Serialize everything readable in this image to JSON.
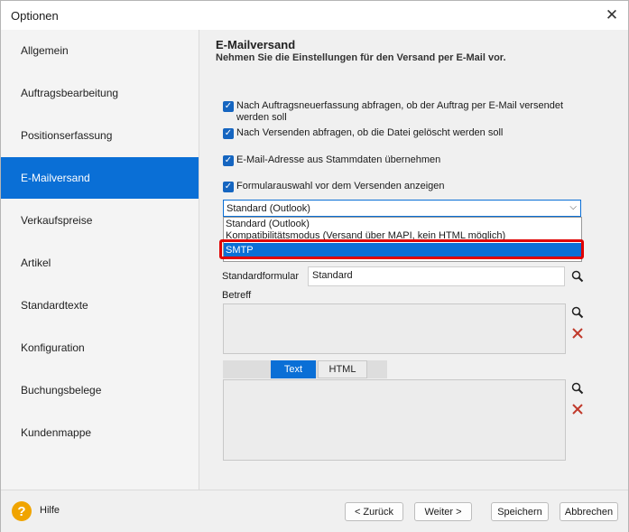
{
  "window": {
    "title": "Optionen"
  },
  "sidebar": {
    "items": [
      {
        "label": "Allgemein"
      },
      {
        "label": "Auftragsbearbeitung"
      },
      {
        "label": "Positionserfassung"
      },
      {
        "label": "E-Mailversand",
        "active": true
      },
      {
        "label": "Verkaufspreise"
      },
      {
        "label": "Artikel"
      },
      {
        "label": "Standardtexte"
      },
      {
        "label": "Konfiguration"
      },
      {
        "label": "Buchungsbelege"
      },
      {
        "label": "Kundenmappe"
      }
    ]
  },
  "section": {
    "title": "E-Mailversand",
    "subtitle": "Nehmen Sie die Einstellungen für den Versand per E-Mail vor."
  },
  "checkboxes": [
    {
      "label": "Nach Auftragsneuerfassung abfragen, ob der Auftrag per E-Mail versendet werden soll",
      "checked": true
    },
    {
      "label": "Nach Versenden abfragen, ob die Datei gelöscht werden soll",
      "checked": true
    },
    {
      "label": "E-Mail-Adresse aus Stammdaten übernehmen",
      "checked": true
    },
    {
      "label": "Formularauswahl vor dem Versenden anzeigen",
      "checked": true
    }
  ],
  "versand_select": {
    "value": "Standard (Outlook)",
    "options": [
      "Standard (Outlook)",
      "Kompatibilitätsmodus (Versand über MAPI, kein HTML möglich)",
      "SMTP"
    ],
    "highlighted_option": "SMTP"
  },
  "standardformular": {
    "label": "Standardformular",
    "value": "Standard"
  },
  "betreff": {
    "label": "Betreff",
    "value": ""
  },
  "editor_tabs": [
    {
      "label": "Text",
      "active": true
    },
    {
      "label": "HTML",
      "active": false
    }
  ],
  "footer": {
    "help_label": "Hilfe",
    "back_label": "< Zurück",
    "next_label": "Weiter >",
    "save_label": "Speichern",
    "cancel_label": "Abbrechen"
  },
  "colors": {
    "accent": "#0a6fd6",
    "highlight_border": "#e00000",
    "help_icon": "#f0a400",
    "delete_icon": "#c0392b"
  }
}
